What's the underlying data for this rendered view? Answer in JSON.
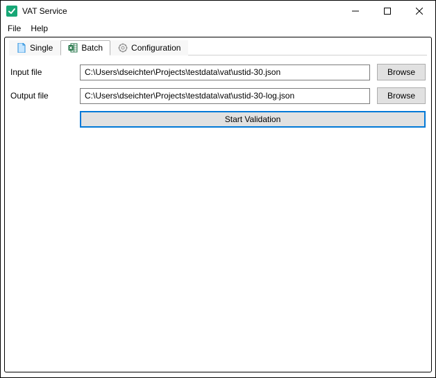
{
  "window": {
    "title": "VAT Service",
    "app_icon": "check"
  },
  "window_controls": {
    "minimize": "minimize",
    "maximize": "maximize",
    "close": "close"
  },
  "menu": {
    "file": "File",
    "help": "Help"
  },
  "tabs": {
    "single": {
      "label": "Single",
      "icon": "file"
    },
    "batch": {
      "label": "Batch",
      "icon": "excel",
      "active": true
    },
    "configuration": {
      "label": "Configuration",
      "icon": "gear"
    }
  },
  "form": {
    "input_file": {
      "label": "Input file",
      "value": "C:\\Users\\dseichter\\Projects\\testdata\\vat\\ustid-30.json",
      "browse": "Browse"
    },
    "output_file": {
      "label": "Output file",
      "value": "C:\\Users\\dseichter\\Projects\\testdata\\vat\\ustid-30-log.json",
      "browse": "Browse"
    },
    "start": "Start Validation"
  }
}
